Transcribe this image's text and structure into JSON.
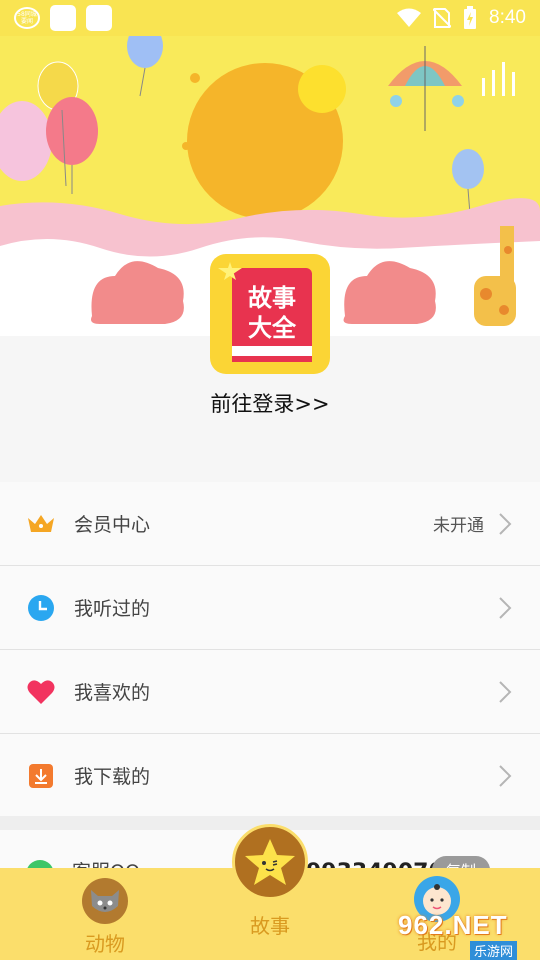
{
  "status_bar": {
    "badge_text": "58同城 要闻",
    "time": "8:40"
  },
  "header": {
    "app_logo_text": [
      "故事",
      "大全"
    ],
    "login_link": "前往登录>>"
  },
  "menu": [
    {
      "label": "会员中心",
      "value": "未开通",
      "icon": "crown-icon"
    },
    {
      "label": "我听过的",
      "value": "",
      "icon": "clock-icon"
    },
    {
      "label": "我喜欢的",
      "value": "",
      "icon": "heart-icon"
    },
    {
      "label": "我下载的",
      "value": "",
      "icon": "download-icon"
    }
  ],
  "service": {
    "label": "客服QQ",
    "number": "993349070",
    "copy_label": "复制"
  },
  "tabs": [
    {
      "label": "动物",
      "icon": "cat-icon"
    },
    {
      "label": "故事",
      "icon": "star-icon"
    },
    {
      "label": "我的",
      "icon": "baby-icon"
    }
  ],
  "watermark": {
    "top": "962.NET",
    "bottom": "乐游网"
  },
  "colors": {
    "status_bar": "#f9e452",
    "tab_bar": "#fbde6b",
    "tab_text": "#d99a20",
    "crown": "#f5a623",
    "clock": "#2aa7f0",
    "heart": "#f2335f",
    "download": "#f37a2e",
    "qq_green": "#3ec667"
  }
}
